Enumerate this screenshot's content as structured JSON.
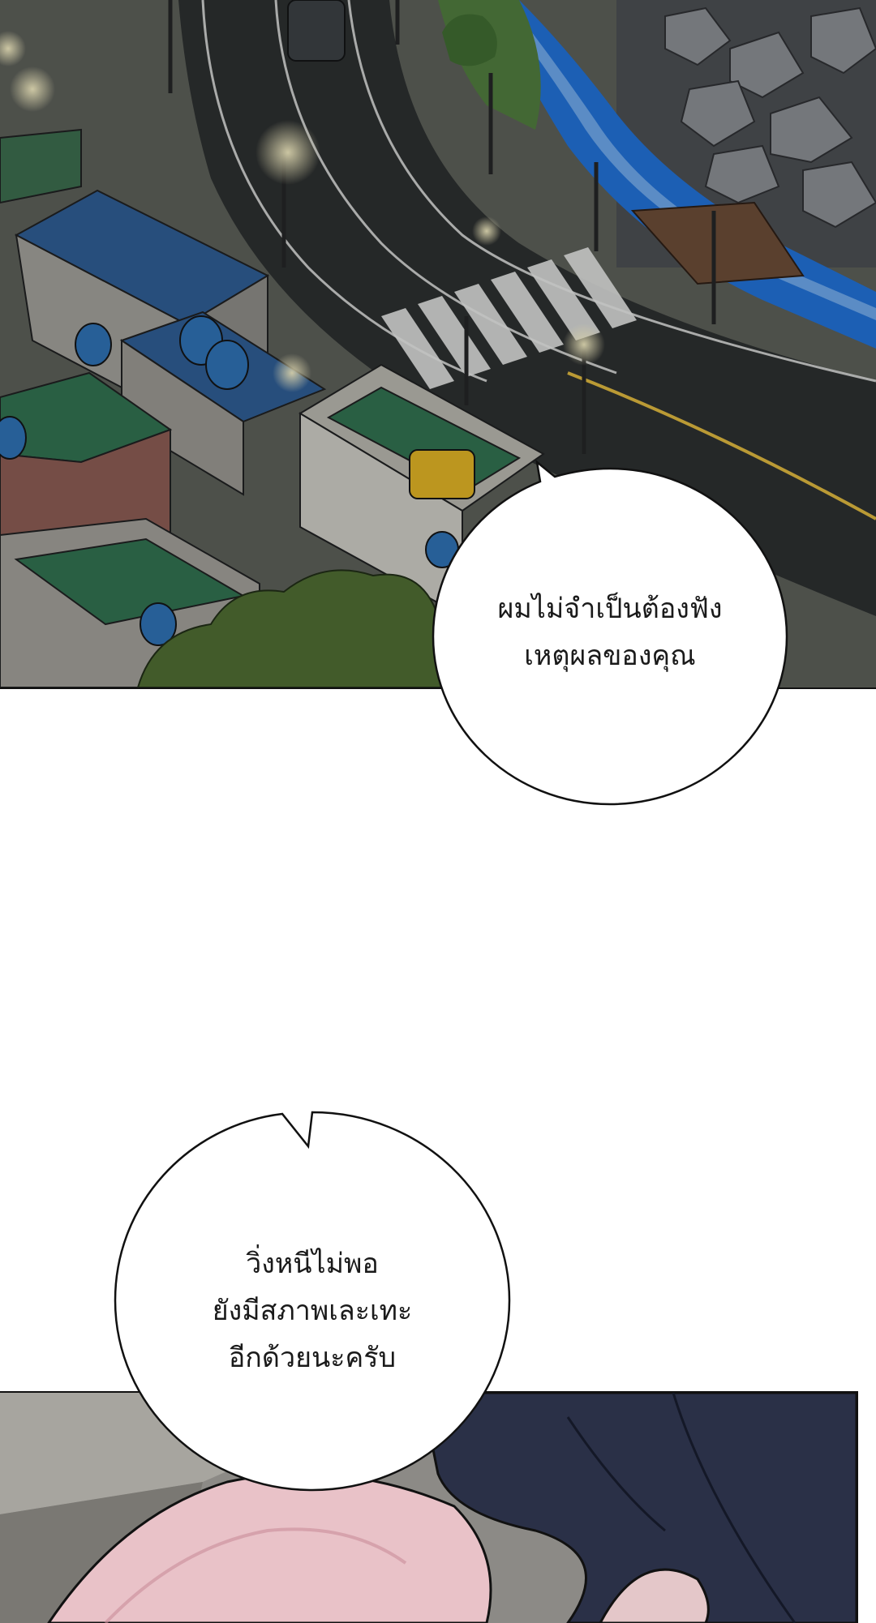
{
  "panels": {
    "top": {
      "description_scene": "night-city-coast-road"
    },
    "bottom": {
      "description_scene": "close-up-figure-dark-skirt"
    }
  },
  "bubbles": [
    {
      "lines": [
        "ผมไม่จำเป็นต้องฟัง",
        "เหตุผลของคุณ"
      ]
    },
    {
      "lines": [
        "วิ่งหนีไม่พอ",
        "ยังมีสภาพเละเทะ",
        "อีกด้วยนะครับ"
      ]
    }
  ],
  "colors": {
    "bubble_fill": "#ffffff",
    "bubble_stroke": "#111111",
    "road": "#2a2c2b",
    "water": "#1f6fd6",
    "rooftop_green": "#2f6f4c",
    "roof_blue": "#2d5b92",
    "skirt": "#2a3047",
    "skin": "#e9c2c8"
  }
}
